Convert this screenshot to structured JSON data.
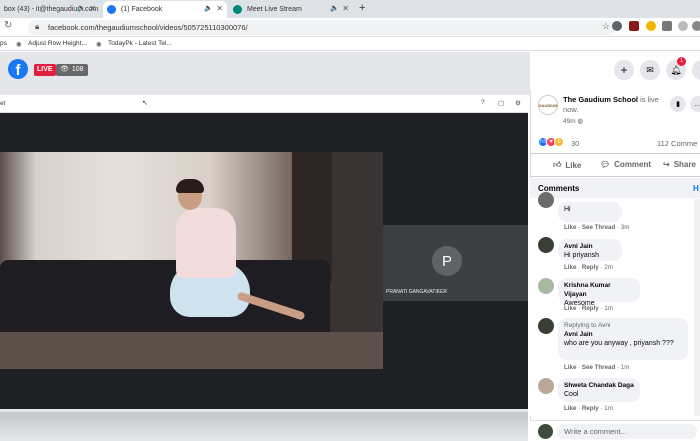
{
  "tabs": [
    {
      "label": "box (43) - it@thegaudium.com"
    },
    {
      "label": "(1) Facebook"
    },
    {
      "label": "Meet Live Stream"
    }
  ],
  "address": {
    "url": "facebook.com/thegaudiumschool/videos/505725110300076/"
  },
  "bookmarks": [
    "ps",
    "Adjust Row Height...",
    "TodayPk - Latest Tel..."
  ],
  "live": {
    "badge": "LIVE",
    "viewers": "108"
  },
  "meet": {
    "strip_label": "et",
    "participant_initial": "P",
    "participant_name": "PRANATI GANGAVATIKER"
  },
  "post": {
    "page_name": "The Gaudium School",
    "status": " is live now.",
    "time": "49m",
    "avatar_text": "GAUDIUM",
    "reactions_count": "30",
    "comments_count": "112 Comme",
    "like_label": "Like",
    "comment_label": "Comment",
    "share_label": "Share",
    "notif_count": "1"
  },
  "comments_header": {
    "label": "Comments",
    "right": "H"
  },
  "comments": [
    {
      "author": "",
      "text": "Hi",
      "like": "Like",
      "action": "See Thread",
      "time": "3m",
      "avatar_color": "#6b6b6b"
    },
    {
      "author": "Avni Jain",
      "text": "Hi priyansh",
      "like": "Like",
      "action": "Reply",
      "time": "2m",
      "avatar_color": "#3a3f35"
    },
    {
      "author": "Krishna Kumar Vijayan",
      "text": "Awesome",
      "like": "Like",
      "action": "Reply",
      "time": "1m",
      "avatar_color": "#a5b8a0"
    },
    {
      "author": "Replying to Avni",
      "author2": "Avni Jain",
      "text": "who are you anyway , priyansh ???",
      "like": "Like",
      "action": "See Thread",
      "time": "1m",
      "avatar_color": "#3a3f35"
    },
    {
      "author": "Shweta Chandak Daga",
      "text": "Cool",
      "like": "Like",
      "action": "Reply",
      "time": "1m",
      "avatar_color": "#b8a898"
    }
  ],
  "write": {
    "placeholder": "Write a comment..."
  }
}
